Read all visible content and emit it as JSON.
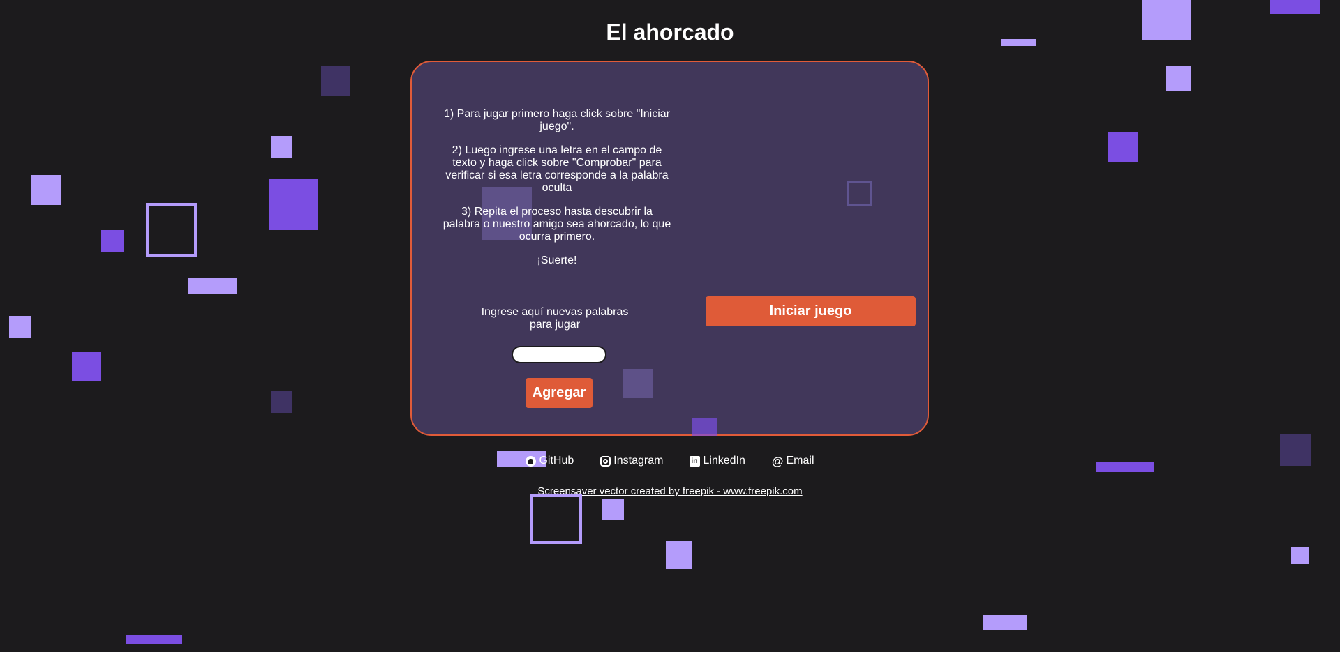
{
  "page": {
    "title": "El ahorcado"
  },
  "instructions": {
    "step1": "1) Para jugar primero haga click sobre \"Iniciar juego\".",
    "step2": "2) Luego ingrese una letra en el campo de texto y haga click sobre \"Comprobar\" para verificar si esa letra corresponde a la palabra oculta",
    "step3": "3) Repita el proceso hasta descubrir la palabra o nuestro amigo sea ahorcado, lo que ocurra primero.",
    "luck": "¡Suerte!"
  },
  "add_word": {
    "label": "Ingrese aquí nuevas palabras para jugar",
    "input_value": "",
    "button": "Agregar"
  },
  "game": {
    "start_button": "Iniciar juego"
  },
  "socials": [
    {
      "label": "GitHub",
      "icon": "github-icon"
    },
    {
      "label": "Instagram",
      "icon": "instagram-icon"
    },
    {
      "label": "LinkedIn",
      "icon": "linkedin-icon"
    },
    {
      "label": "Email",
      "icon": "at-icon"
    }
  ],
  "footer": {
    "credit": "Screensaver vector created by freepik - www.freepik.com"
  },
  "colors": {
    "background": "#1c1b1d",
    "card": "#41375a",
    "accent": "#df5b38",
    "square_light": "#b49cfb",
    "square_mid": "#7b4ee2",
    "square_dark": "#3f3364"
  }
}
